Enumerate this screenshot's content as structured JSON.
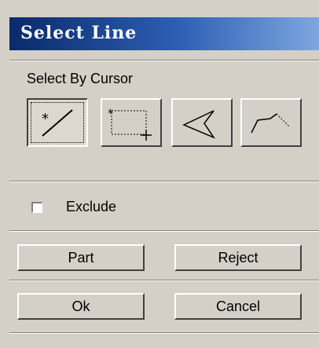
{
  "window": {
    "title": "Select Line"
  },
  "select_section": {
    "label": "Select By Cursor",
    "tools": [
      {
        "icon": "single-line-pick-icon",
        "selected": true
      },
      {
        "icon": "box-select-icon",
        "selected": false
      },
      {
        "icon": "polygon-select-icon",
        "selected": false
      },
      {
        "icon": "polyline-select-icon",
        "selected": false
      }
    ]
  },
  "options": {
    "exclude_label": "Exclude",
    "exclude_checked": false
  },
  "buttons": {
    "part": "Part",
    "reject": "Reject",
    "ok": "Ok",
    "cancel": "Cancel"
  },
  "colors": {
    "title_bar_start": "#0a2a6b",
    "title_bar_end": "#7ea7e0",
    "panel": "#d4d0c8"
  }
}
